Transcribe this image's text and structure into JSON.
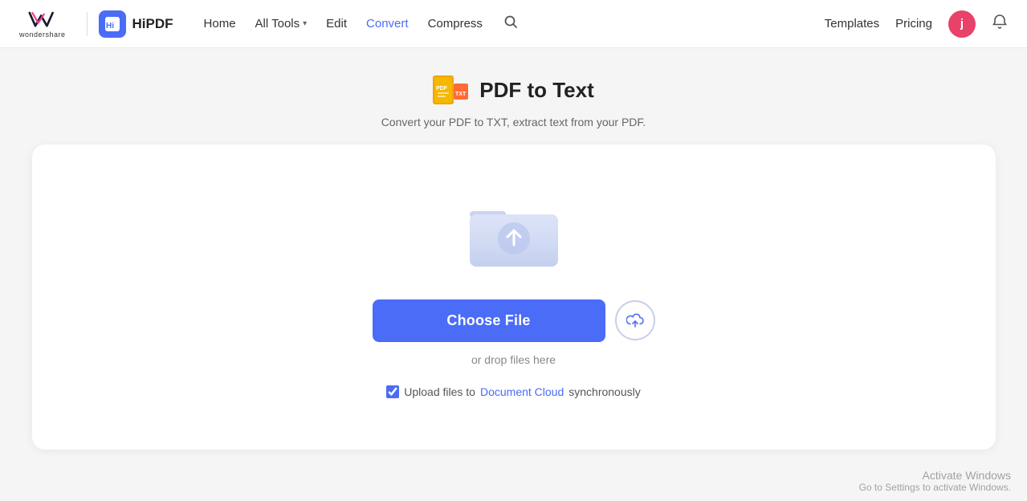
{
  "header": {
    "wondershare_label": "wondershare",
    "hipdf_label": "HiPDF",
    "nav": {
      "home": "Home",
      "all_tools": "All Tools",
      "edit": "Edit",
      "convert": "Convert",
      "compress": "Compress",
      "templates": "Templates",
      "pricing": "Pricing"
    },
    "user_initial": "j"
  },
  "page": {
    "title": "PDF to Text",
    "subtitle": "Convert your PDF to TXT, extract text from your PDF."
  },
  "upload": {
    "choose_file_label": "Choose File",
    "drop_hint": "or drop files here",
    "upload_checkbox_text": "Upload files to",
    "document_cloud_link": "Document Cloud",
    "upload_suffix": "synchronously"
  },
  "activate_windows": {
    "title": "Activate Windows",
    "subtitle": "Go to Settings to activate Windows."
  }
}
